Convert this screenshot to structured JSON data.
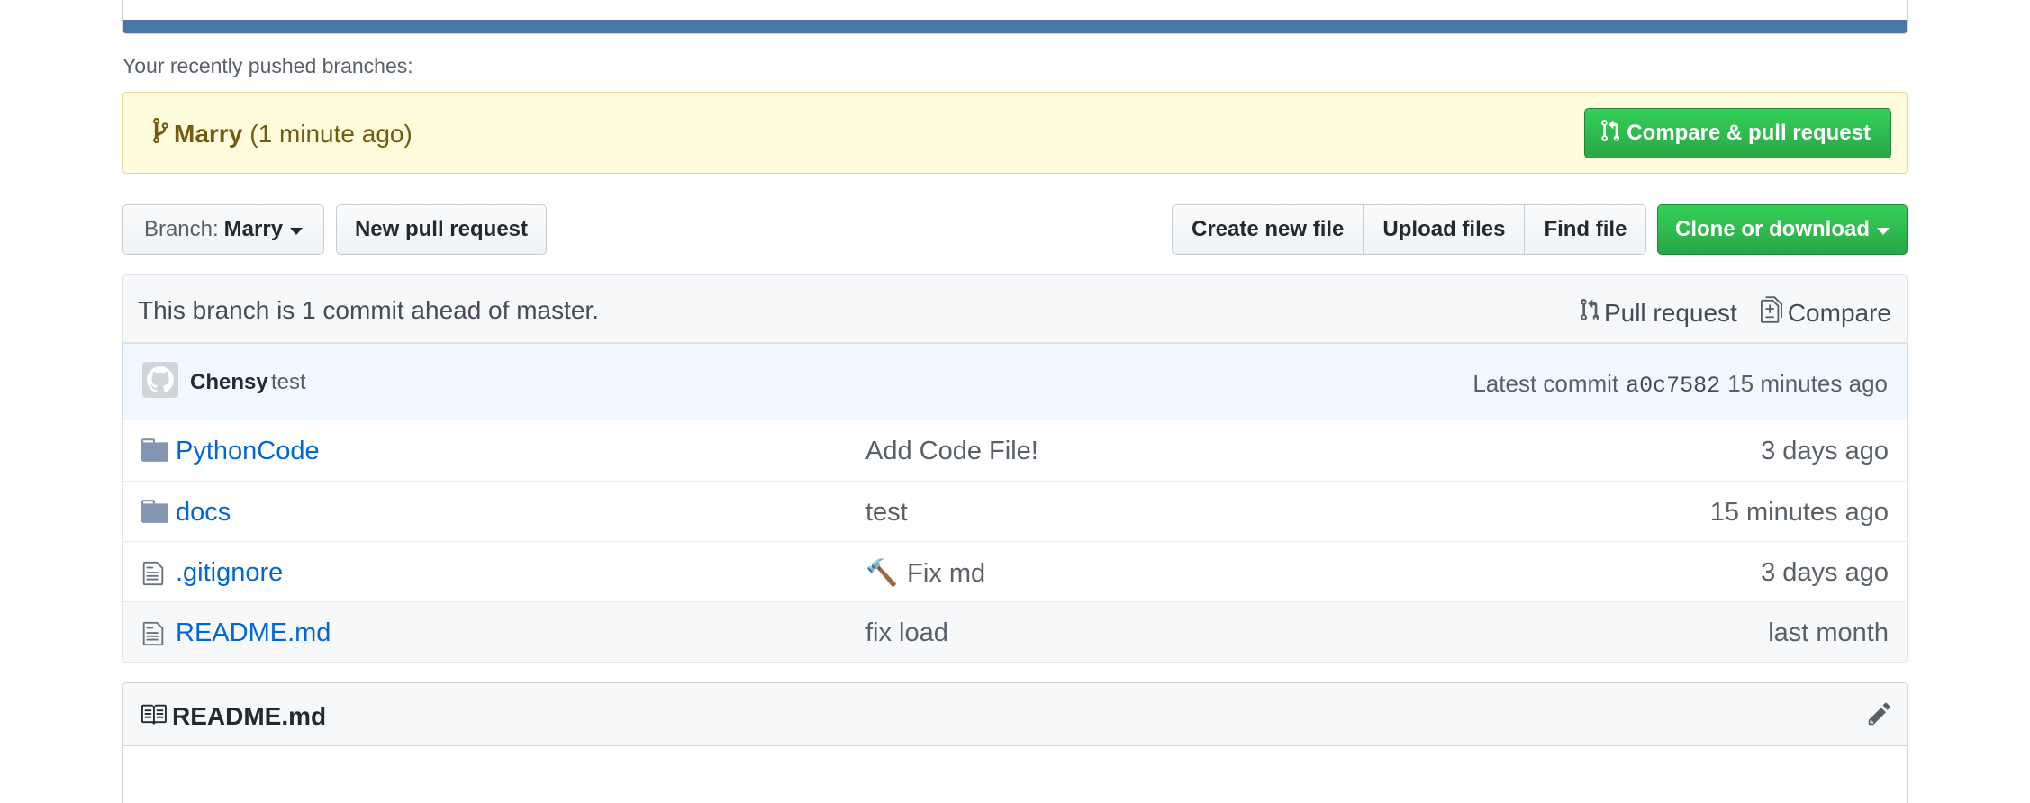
{
  "recent": {
    "label": "Your recently pushed branches:",
    "branch": "Marry",
    "time": "(1 minute ago)",
    "compare_label": "Compare & pull request"
  },
  "toolbar": {
    "branch_label": "Branch:",
    "branch_value": "Marry",
    "new_pr_label": "New pull request",
    "create_file_label": "Create new file",
    "upload_label": "Upload files",
    "find_label": "Find file",
    "clone_label": "Clone or download"
  },
  "tease": {
    "message": "This branch is 1 commit ahead of master.",
    "pull_request_label": "Pull request",
    "compare_label": "Compare"
  },
  "commit": {
    "author": "Chensy",
    "message": "test",
    "latest_label": "Latest commit",
    "sha": "a0c7582",
    "time": "15 minutes ago"
  },
  "files": [
    {
      "name": "PythonCode",
      "type": "folder",
      "commit": "Add Code File!",
      "age": "3 days ago",
      "emoji": ""
    },
    {
      "name": "docs",
      "type": "folder",
      "commit": "test",
      "age": "15 minutes ago",
      "emoji": ""
    },
    {
      "name": ".gitignore",
      "type": "file",
      "commit": "Fix md",
      "age": "3 days ago",
      "emoji": "🔨"
    },
    {
      "name": "README.md",
      "type": "file",
      "commit": "fix load",
      "age": "last month",
      "emoji": ""
    }
  ],
  "readme": {
    "title": "README.md"
  },
  "colors": {
    "link": "#0366d6",
    "green": "#28a745",
    "banner_bg": "#fffbdd",
    "top_bar": "#4a75a8"
  }
}
